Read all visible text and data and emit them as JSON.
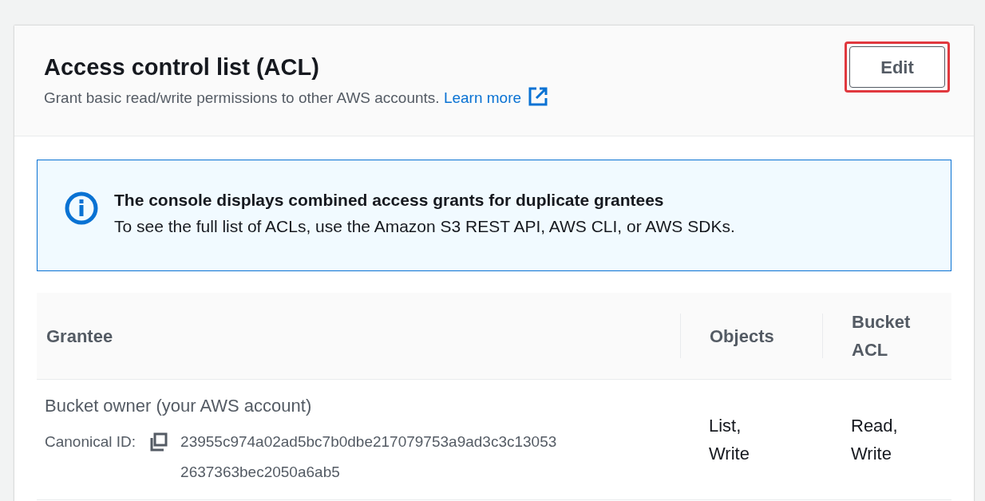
{
  "header": {
    "title": "Access control list (ACL)",
    "description": "Grant basic read/write permissions to other AWS accounts.",
    "learn_more": "Learn more",
    "edit_button": {
      "label": "Edit",
      "highlighted": true
    }
  },
  "info_alert": {
    "title": "The console displays combined access grants for duplicate grantees",
    "message": "To see the full list of ACLs, use the Amazon S3 REST API, AWS CLI, or AWS SDKs."
  },
  "table": {
    "columns": [
      "Grantee",
      "Objects",
      "Bucket ACL"
    ],
    "rows": [
      {
        "grantee": "Bucket owner (your AWS account)",
        "id_label": "Canonical ID:",
        "canonical_id": "23955c974a02ad5bc7b0dbe217079753a9ad3c3c130532637363bec2050a6ab5",
        "objects": "List, Write",
        "bucket_acl": "Read, Write"
      }
    ]
  }
}
